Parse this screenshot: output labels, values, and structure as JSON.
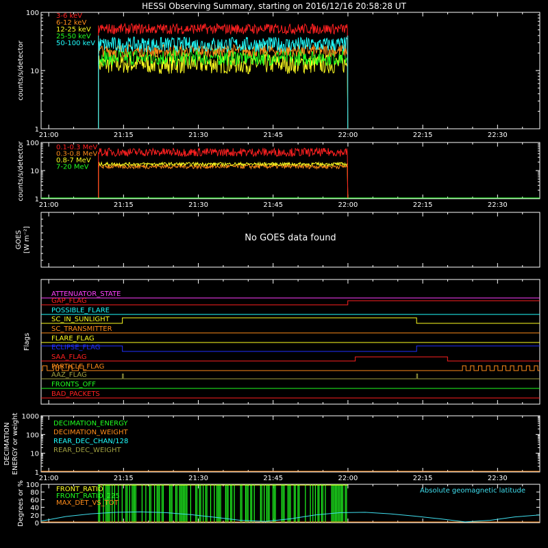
{
  "title": "HESSI Observing Summary, starting on 2016/12/16 20:58:28 UT",
  "colors": {
    "background": "#000000",
    "axis": "#ffffff",
    "red": "#ff2020",
    "orange": "#ff8c1a",
    "yellow": "#ffff20",
    "green": "#20ff20",
    "cyan": "#20ffff",
    "magenta": "#ff40ff",
    "blue": "#2030ff",
    "olive": "#a0a040",
    "lightcyan": "#40e0f0"
  },
  "time_axis": {
    "start_min": 0,
    "end_min": 100,
    "tick_labels": [
      "21:00",
      "21:15",
      "21:30",
      "21:45",
      "22:00",
      "22:15",
      "22:30"
    ],
    "tick_times_min": [
      1.53,
      16.53,
      31.53,
      46.53,
      61.53,
      76.53,
      91.53
    ]
  },
  "panels": {
    "p1": {
      "ylabel": "counts/s/detector",
      "scale": "log",
      "ylim": [
        1,
        100
      ],
      "tick_labels": [
        "1",
        "10",
        "100"
      ]
    },
    "p2": {
      "ylabel": "counts/s/detector",
      "scale": "log",
      "ylim": [
        1,
        100
      ],
      "tick_labels": [
        "1",
        "10",
        "100"
      ]
    },
    "p3": {
      "ylabel_line1": "GOES",
      "ylabel_line2": "[W m⁻²]",
      "message": "No GOES data found"
    },
    "p4": {
      "ylabel": "Flags"
    },
    "p5": {
      "ylabel_line1": "DECIMATION",
      "ylabel_line2": "ENERGY or weight",
      "scale": "log",
      "ylim": [
        1,
        1000
      ],
      "tick_labels": [
        "1",
        "10",
        "100",
        "1000"
      ]
    },
    "p6": {
      "ylabel": "Degrees or %",
      "scale": "linear",
      "ylim": [
        0,
        100
      ],
      "tick_labels": [
        "0",
        "20",
        "40",
        "60",
        "80",
        "100"
      ],
      "right_label": "Absolute geomagnetic latitude"
    }
  },
  "chart_data": {
    "type": "line",
    "title": "HESSI Observing Summary, starting on 2016/12/16 20:58:28 UT",
    "x_unit": "UT",
    "x_range": [
      "20:58:28",
      "22:38:28"
    ],
    "data_window": [
      "21:10",
      "22:00"
    ],
    "rate_series_low": [
      {
        "name": "3-6 keV",
        "color": "#ff2020",
        "value": 52
      },
      {
        "name": "6-12 keV",
        "color": "#ff8c1a",
        "value": 22
      },
      {
        "name": "12-25 keV",
        "color": "#ffff20",
        "value": 13
      },
      {
        "name": "25-50 keV",
        "color": "#20ff20",
        "value": 17
      },
      {
        "name": "50-100 keV",
        "color": "#20ffff",
        "value": 28
      }
    ],
    "rate_series_high": [
      {
        "name": "0.1-0.3 MeV",
        "color": "#ff2020",
        "value": 45
      },
      {
        "name": "0.3-0.8 MeV",
        "color": "#ff8c1a",
        "value": 14
      },
      {
        "name": "0.8-7 MeV",
        "color": "#ffff20",
        "value": 17
      },
      {
        "name": "7-20 MeV",
        "color": "#20ff20",
        "value": 1
      }
    ],
    "flags": [
      {
        "name": "ATTENUATOR_STATE",
        "color": "#ff40ff",
        "state": "off"
      },
      {
        "name": "GAP_FLAG",
        "color": "#ff2020",
        "state": "on from 22:00"
      },
      {
        "name": "POSSIBLE_FLARE",
        "color": "#20ffff",
        "state": "off"
      },
      {
        "name": "SC_IN_SUNLIGHT",
        "color": "#ffff20",
        "state": "on 21:15 - 22:14"
      },
      {
        "name": "SC_TRANSMITTER",
        "color": "#ff8c1a",
        "state": "off"
      },
      {
        "name": "FLARE_FLAG",
        "color": "#ffff20",
        "state": "off"
      },
      {
        "name": "ECLIPSE_FLAG",
        "color": "#2030ff",
        "state": "on outside 21:15 - 22:14"
      },
      {
        "name": "SAA_FLAG",
        "color": "#ff2020",
        "state": "on 22:01 - 22:20"
      },
      {
        "name": "PARTICLE_FLAG",
        "color": "#ff8c1a",
        "state": "intermittent"
      },
      {
        "name": "AAZ_FLAG",
        "color": "#a0a040",
        "state": "spikes 21:15, 22:14"
      },
      {
        "name": "FRONTS_OFF",
        "color": "#20ff20",
        "state": "off"
      },
      {
        "name": "BAD_PACKETS",
        "color": "#ff2020",
        "state": "off"
      }
    ],
    "decimation_legend": [
      {
        "name": "DECIMATION_ENERGY",
        "color": "#20ff20"
      },
      {
        "name": "DECIMATION_WEIGHT",
        "color": "#ff8c1a"
      },
      {
        "name": "REAR_DEC_CHAN/128",
        "color": "#20ffff"
      },
      {
        "name": "REAR_DEC_WEIGHT",
        "color": "#a0a040"
      }
    ],
    "ratio_legend": [
      {
        "name": "FRONT_RATIO",
        "color": "#ffff20"
      },
      {
        "name": "FRONT_RATIO_225",
        "color": "#20ff20"
      },
      {
        "name": "MAX_DET_VS_TOT",
        "color": "#ff8c1a"
      }
    ],
    "geomag_latitude": {
      "name": "Absolute geomagnetic latitude",
      "times": [
        "20:58",
        "21:05",
        "21:10",
        "21:15",
        "21:20",
        "21:25",
        "21:30",
        "21:35",
        "21:40",
        "21:45",
        "21:50",
        "21:55",
        "22:00",
        "22:05",
        "22:10",
        "22:15",
        "22:20",
        "22:25",
        "22:30",
        "22:35",
        "22:38"
      ],
      "values": [
        4,
        16,
        23,
        27,
        28,
        26,
        21,
        14,
        6,
        3,
        10,
        20,
        26,
        27,
        23,
        17,
        10,
        2,
        6,
        15,
        20
      ]
    }
  }
}
